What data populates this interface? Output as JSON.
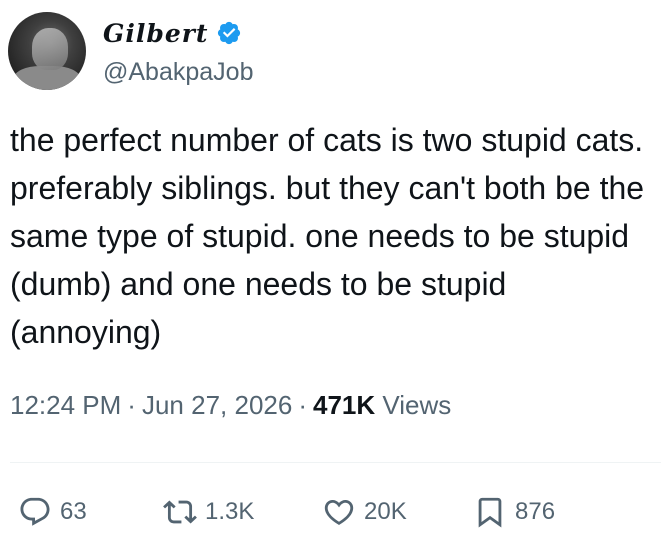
{
  "author": {
    "display_name": "Gilbert",
    "handle": "@AbakpaJob",
    "verified": true,
    "verified_color": "#1d9bf0"
  },
  "tweet": {
    "text": "the perfect number of cats is two stupid cats. preferably siblings. but they can't both be the same type of stupid. one needs to be stupid (dumb) and one needs to be stupid (annoying)",
    "time": "12:24 PM",
    "date": "Jun 27, 2026",
    "views_count": "471K",
    "views_label": "Views"
  },
  "actions": {
    "reply_count": "63",
    "retweet_count": "1.3K",
    "like_count": "20K",
    "bookmark_count": "876"
  },
  "icons": {
    "reply": "reply-bubble-icon",
    "retweet": "retweet-icon",
    "like": "heart-icon",
    "bookmark": "bookmark-icon",
    "verified": "verified-badge-icon"
  },
  "colors": {
    "text_primary": "#0f1419",
    "text_secondary": "#536471",
    "divider": "#eff3f4"
  }
}
